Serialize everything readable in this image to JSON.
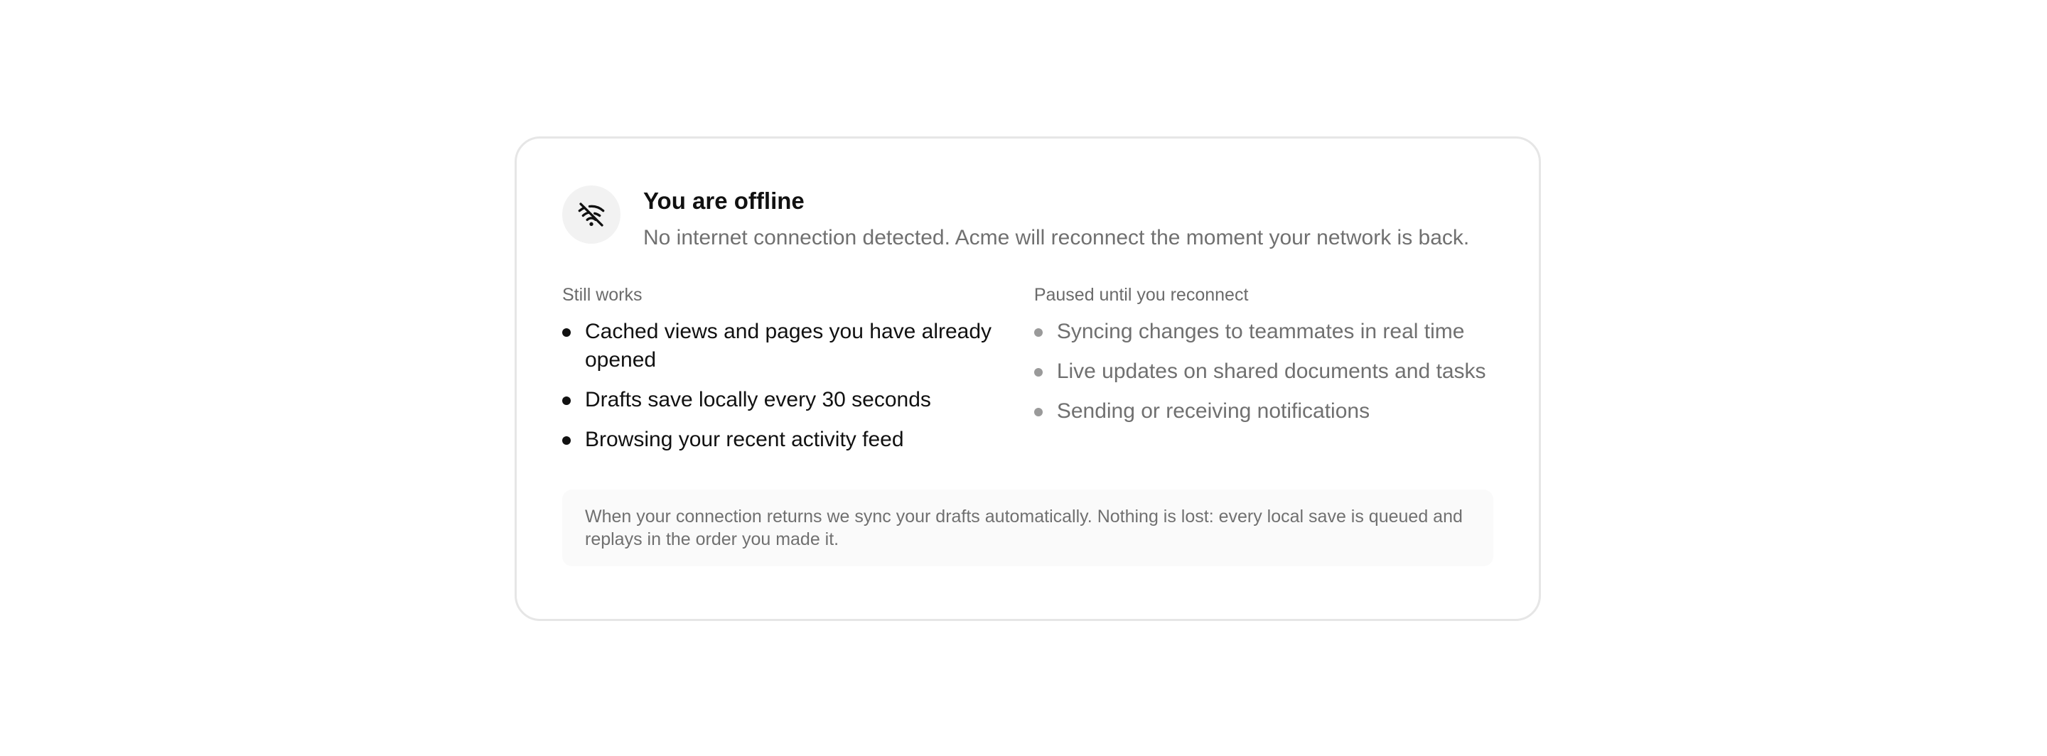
{
  "header": {
    "icon": "wifi-off-icon",
    "title": "You are offline",
    "subtitle": "No internet connection detected. Acme will reconnect the moment your network is back."
  },
  "still_works": {
    "label": "Still works",
    "items": [
      "Cached views and pages you have already opened",
      "Drafts save locally every 30 seconds",
      "Browsing your recent activity feed"
    ]
  },
  "paused": {
    "label": "Paused until you reconnect",
    "items": [
      "Syncing changes to teammates in real time",
      "Live updates on shared documents and tasks",
      "Sending or receiving notifications"
    ]
  },
  "note": "When your connection returns we sync your drafts automatically. Nothing is lost: every local save is queued and replays in the order you made it.",
  "colors": {
    "card_border": "#e6e6e6",
    "muted_text": "#707070",
    "icon_bg": "#f2f2f2"
  }
}
